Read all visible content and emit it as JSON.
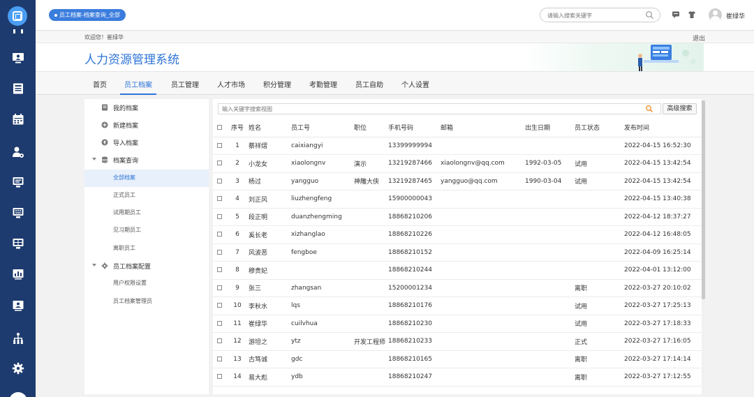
{
  "breadcrumb": "员工档案-档案查询_全部",
  "search": {
    "placeholder": "请输入搜索关键字"
  },
  "user": {
    "name": "崔绿华"
  },
  "welcome": {
    "greeting": "欢迎您！崔绿华",
    "logout": "退出"
  },
  "app": {
    "title": "人力资源管理系统"
  },
  "nav": [
    "首页",
    "员工档案",
    "员工管理",
    "人才市场",
    "积分管理",
    "考勤管理",
    "员工自助",
    "个人设置"
  ],
  "sidebar": {
    "my_archive": "我的档案",
    "new_archive": "新建档案",
    "import_archive": "导入档案",
    "query": "档案查询",
    "query_items": [
      "全部档案",
      "正式员工",
      "试用期员工",
      "见习期员工",
      "离职员工"
    ],
    "config": "员工档案配置",
    "config_items": [
      "用户权限设置",
      "员工档案管理员"
    ]
  },
  "table": {
    "search_placeholder": "输入关键字搜索视图",
    "advanced_search": "高级搜索",
    "headers": [
      "序号",
      "姓名",
      "员工号",
      "职位",
      "手机号码",
      "邮箱",
      "出生日期",
      "员工状态",
      "发布时间"
    ],
    "rows": [
      [
        "1",
        "蔡祥熠",
        "caixiangyi",
        "",
        "13399999994",
        "",
        "",
        "",
        "2022-04-15 16:52:30"
      ],
      [
        "2",
        "小龙女",
        "xiaolongnv",
        "演示",
        "13219287466",
        "xiaolongnv@qq.com",
        "1992-03-05",
        "试用",
        "2022-04-15 13:42:54"
      ],
      [
        "3",
        "杨过",
        "yangguo",
        "神雕大侠",
        "13219287465",
        "yangguo@qq.com",
        "1990-03-04",
        "试用",
        "2022-04-15 13:42:54"
      ],
      [
        "4",
        "刘正风",
        "liuzhengfeng",
        "",
        "15900000043",
        "",
        "",
        "",
        "2022-04-15 13:40:38"
      ],
      [
        "5",
        "段正明",
        "duanzhengming",
        "",
        "18868210206",
        "",
        "",
        "",
        "2022-04-12 18:37:27"
      ],
      [
        "6",
        "奚长老",
        "xizhanglao",
        "",
        "18868210226",
        "",
        "",
        "",
        "2022-04-12 16:48:05"
      ],
      [
        "7",
        "风波恶",
        "fengboe",
        "",
        "18868210152",
        "",
        "",
        "",
        "2022-04-09 16:25:14"
      ],
      [
        "8",
        "穆贵妃",
        "",
        "",
        "18868210244",
        "",
        "",
        "",
        "2022-04-01 13:12:00"
      ],
      [
        "9",
        "张三",
        "zhangsan",
        "",
        "15200001234",
        "",
        "",
        "离职",
        "2022-03-27 20:10:02"
      ],
      [
        "10",
        "李秋水",
        "lqs",
        "",
        "18868210176",
        "",
        "",
        "试用",
        "2022-03-27 17:25:13"
      ],
      [
        "11",
        "崔绿华",
        "cuilvhua",
        "",
        "18868210230",
        "",
        "",
        "试用",
        "2022-03-27 17:18:33"
      ],
      [
        "12",
        "游坦之",
        "ytz",
        "开发工程师",
        "18868210233",
        "",
        "",
        "正式",
        "2022-03-27 17:16:05"
      ],
      [
        "13",
        "古笃诚",
        "gdc",
        "",
        "18868210165",
        "",
        "",
        "离职",
        "2022-03-27 17:14:14"
      ],
      [
        "14",
        "易大彪",
        "ydb",
        "",
        "18868210247",
        "",
        "",
        "离职",
        "2022-03-27 17:12:55"
      ]
    ]
  },
  "colors": {
    "rail": "#1d3b6e",
    "accent": "#2d74d8",
    "pill": "#3b7ddd"
  }
}
